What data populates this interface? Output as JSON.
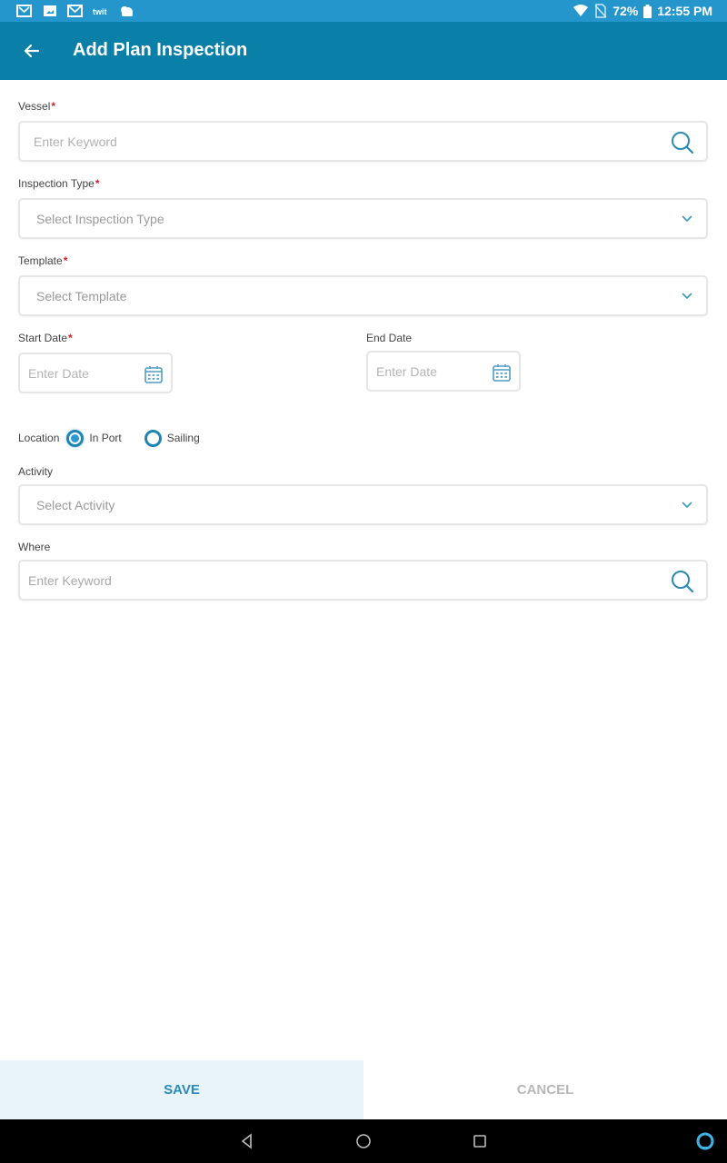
{
  "status_bar": {
    "left_icons": [
      "gallery-mail-icon",
      "image-icon",
      "gmail-icon",
      "app-text-icon",
      "weather-icon"
    ],
    "battery": "72%",
    "time": "12:55 PM"
  },
  "app_bar": {
    "title": "Add Plan Inspection",
    "back_icon": "arrow-left-icon"
  },
  "form": {
    "vessel": {
      "label": "Vessel",
      "required": "*",
      "placeholder": "Enter Keyword"
    },
    "inspection_type": {
      "label": "Inspection Type",
      "required": "*",
      "placeholder": "Select Inspection Type"
    },
    "template": {
      "label": "Template",
      "required": "*",
      "placeholder": "Select Template"
    },
    "start_date": {
      "label": "Start Date",
      "required": "*",
      "placeholder": "Enter Date"
    },
    "end_date": {
      "label": "End Date",
      "placeholder": "Enter Date"
    },
    "location": {
      "label": "Location",
      "options": [
        {
          "label": "In Port",
          "selected": true
        },
        {
          "label": "Sailing",
          "selected": false
        }
      ]
    },
    "activity": {
      "label": "Activity",
      "placeholder": "Select Activity"
    },
    "where": {
      "label": "Where",
      "placeholder": "Enter Keyword"
    }
  },
  "buttons": {
    "save": "SAVE",
    "cancel": "CANCEL"
  },
  "colors": {
    "status_bar": "#2596cc",
    "app_bar": "#0a7fa8",
    "accent": "#2b8ab4",
    "required": "#d0202a",
    "save_bg": "#e8f4f9"
  }
}
